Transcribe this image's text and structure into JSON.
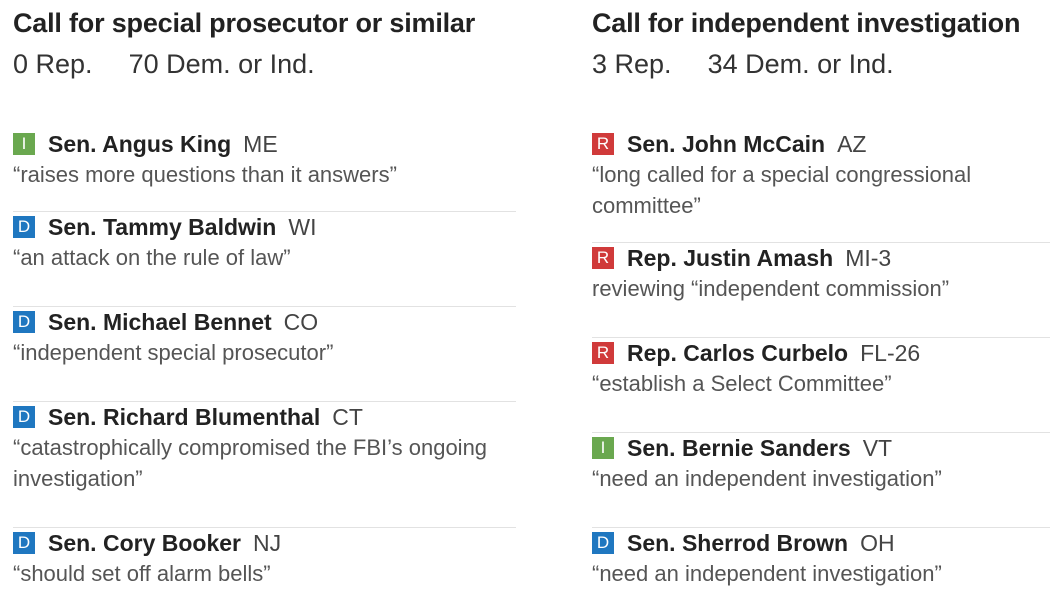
{
  "colors": {
    "I": "#6aa84f",
    "D": "#1f77c0",
    "R": "#d03a3a"
  },
  "left": {
    "title": "Call for special prosecutor or similar",
    "rep_count": "0 Rep.",
    "dem_count": "70 Dem. or Ind.",
    "entries": [
      {
        "party": "I",
        "name": "Sen. Angus King",
        "state": "ME",
        "quote": "“raises more questions than it answers”"
      },
      {
        "party": "D",
        "name": "Sen. Tammy Baldwin",
        "state": "WI",
        "quote": "“an attack on the rule of law”"
      },
      {
        "party": "D",
        "name": "Sen. Michael Bennet",
        "state": "CO",
        "quote": "“independent special prosecutor”"
      },
      {
        "party": "D",
        "name": "Sen. Richard Blumenthal",
        "state": "CT",
        "quote": "“catastrophically compromised the FBI’s ongoing investigation”"
      },
      {
        "party": "D",
        "name": "Sen. Cory Booker",
        "state": "NJ",
        "quote": "“should set off alarm bells”"
      }
    ]
  },
  "right": {
    "title": "Call for independent investigation",
    "rep_count": "3 Rep.",
    "dem_count": "34 Dem. or Ind.",
    "entries": [
      {
        "party": "R",
        "name": "Sen. John McCain",
        "state": "AZ",
        "quote": "“long called for a special congressional committee”"
      },
      {
        "party": "R",
        "name": "Rep. Justin Amash",
        "state": "MI-3",
        "quote": "reviewing “independent commission”"
      },
      {
        "party": "R",
        "name": "Rep. Carlos Curbelo",
        "state": "FL-26",
        "quote": "“establish a Select Committee”"
      },
      {
        "party": "I",
        "name": "Sen. Bernie Sanders",
        "state": "VT",
        "quote": "“need an independent investigation”"
      },
      {
        "party": "D",
        "name": "Sen. Sherrod Brown",
        "state": "OH",
        "quote": "“need an independent investigation”"
      }
    ]
  }
}
